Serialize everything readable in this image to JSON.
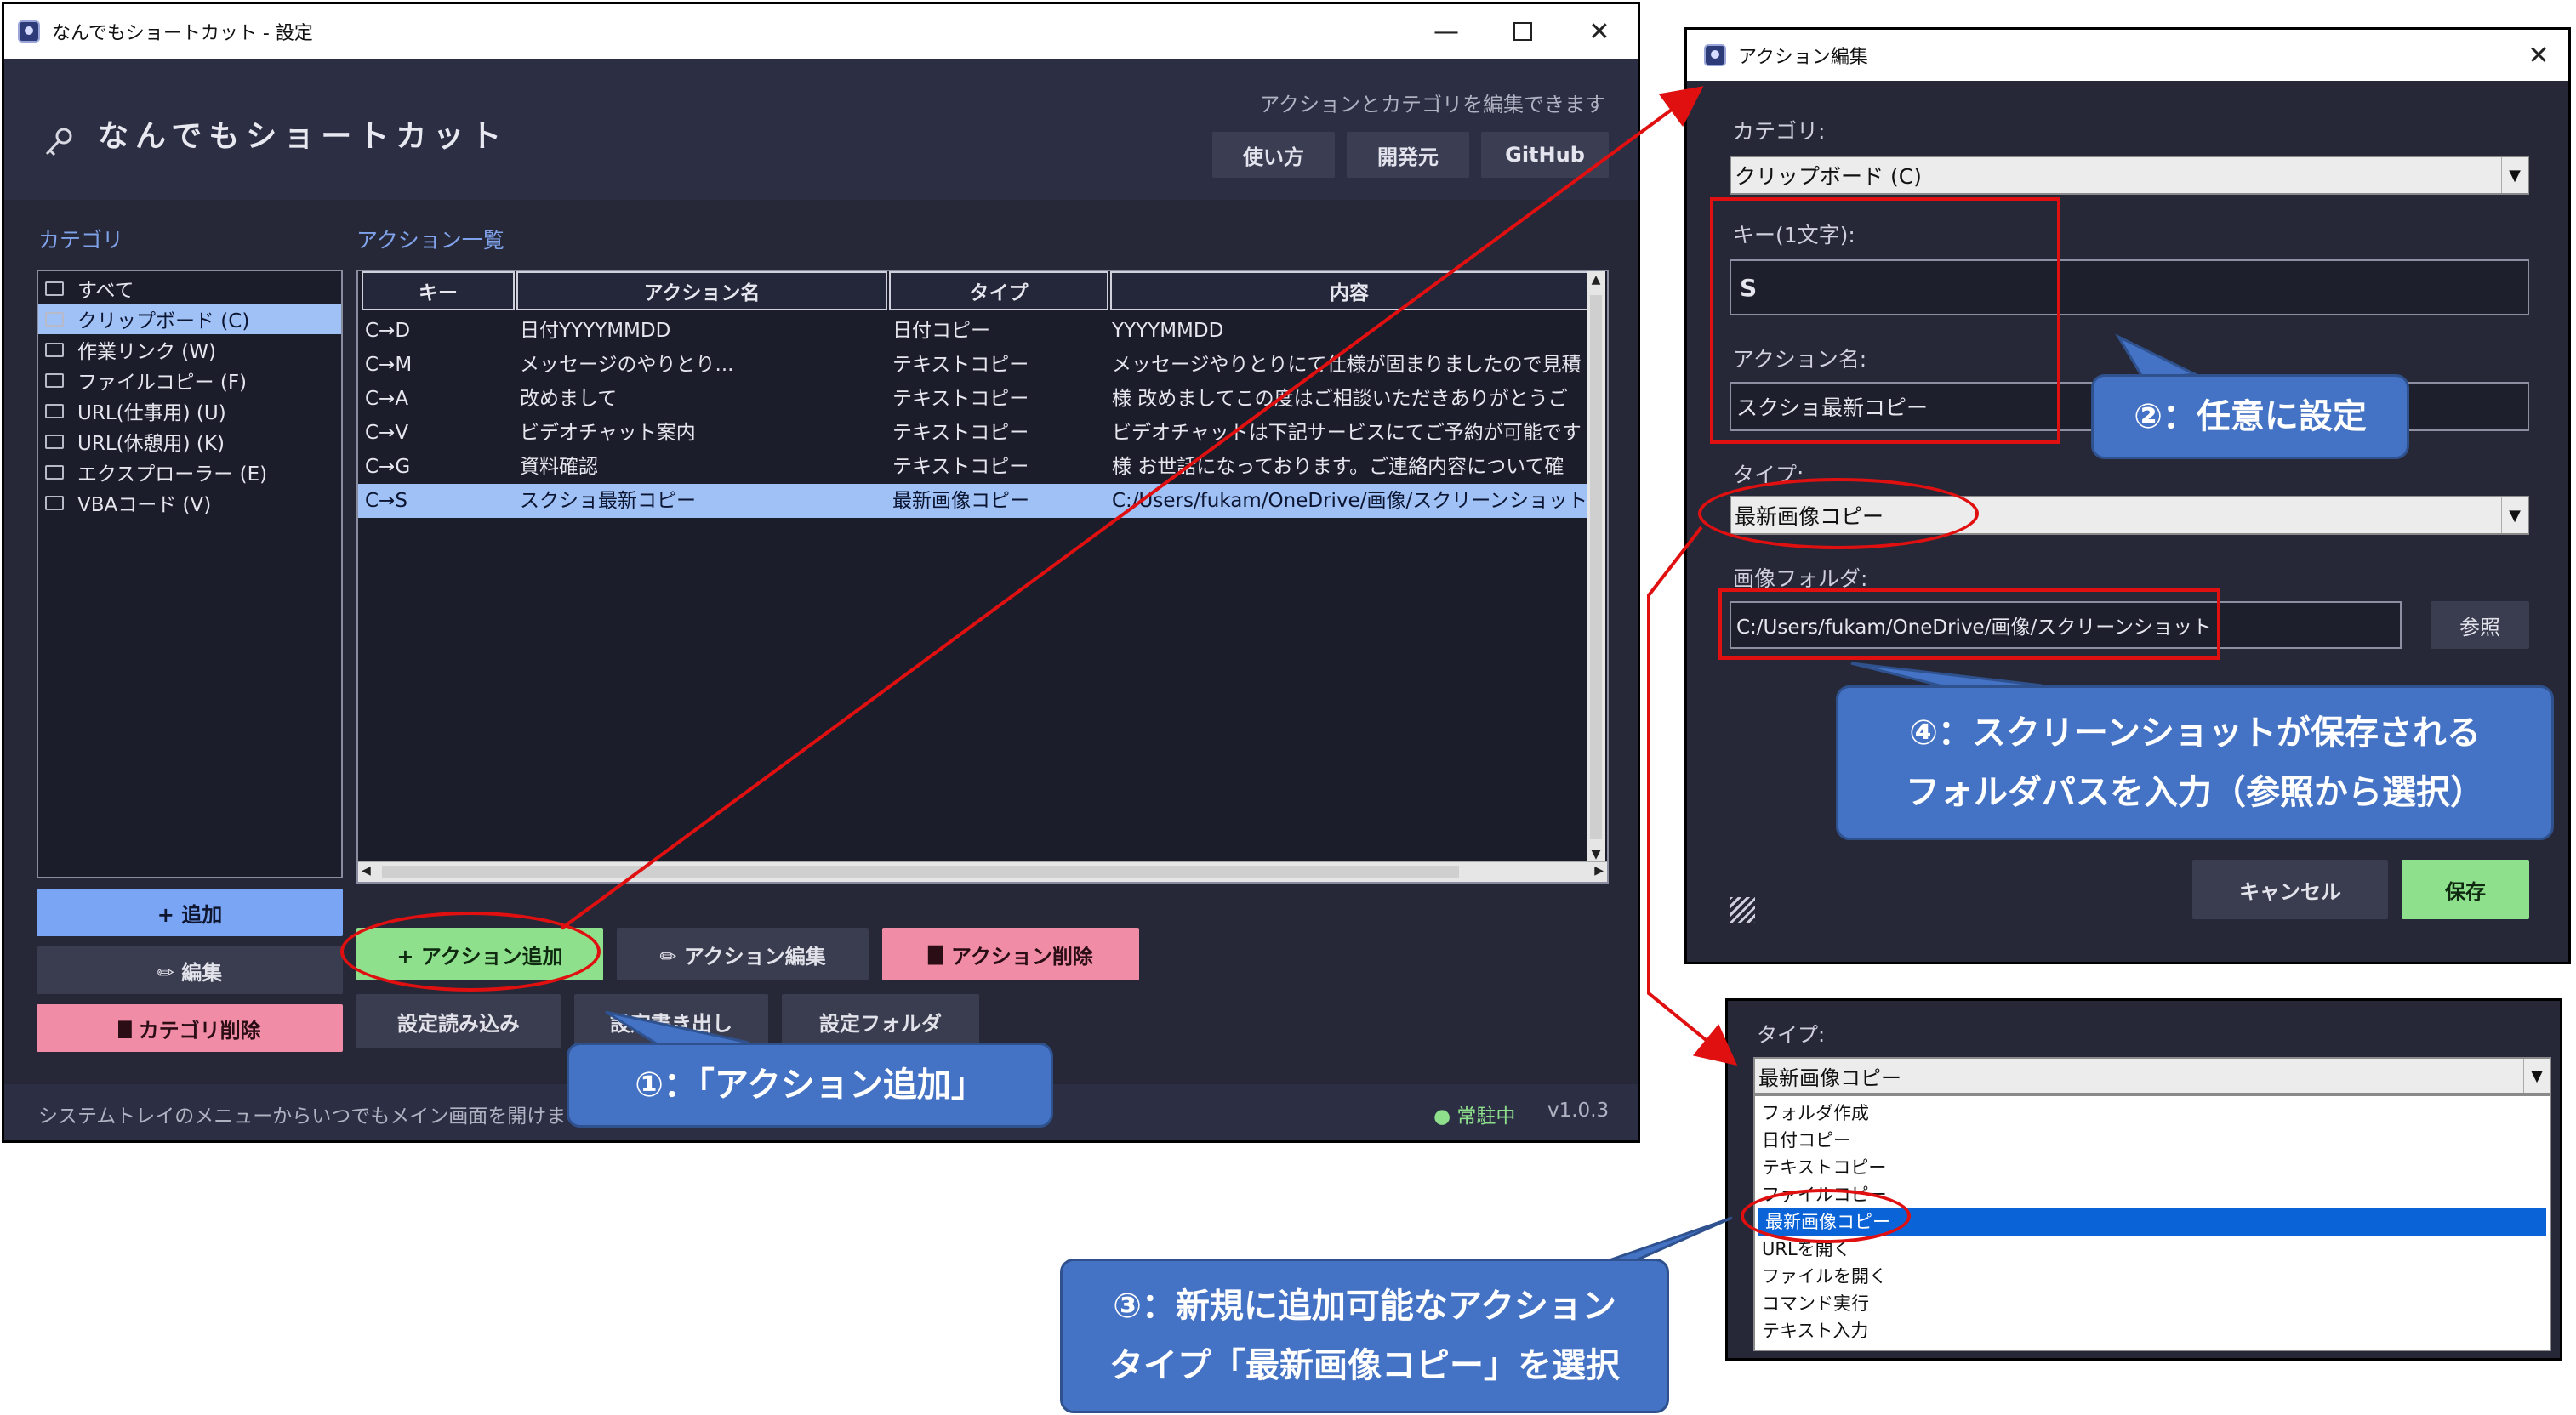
{
  "main_window": {
    "title": "なんでもショートカット - 設定",
    "app_name": "なんでもショートカット",
    "subtitle": "アクションとカテゴリを編集できます",
    "header_buttons": [
      "使い方",
      "開発元",
      "GitHub"
    ],
    "category_label": "カテゴリ",
    "action_list_label": "アクション一覧",
    "categories": [
      {
        "label": "すべて",
        "selected": false
      },
      {
        "label": "クリップボード (C)",
        "selected": true
      },
      {
        "label": "作業リンク (W)",
        "selected": false
      },
      {
        "label": "ファイルコピー (F)",
        "selected": false
      },
      {
        "label": "URL(仕事用) (U)",
        "selected": false
      },
      {
        "label": "URL(休憩用) (K)",
        "selected": false
      },
      {
        "label": "エクスプローラー (E)",
        "selected": false
      },
      {
        "label": "VBAコード (V)",
        "selected": false
      }
    ],
    "table": {
      "headers": [
        "キー",
        "アクション名",
        "タイプ",
        "内容"
      ],
      "rows": [
        {
          "key": "C→D",
          "name": "日付YYYYMMDD",
          "type": "日付コピー",
          "content": "YYYYMMDD",
          "selected": false
        },
        {
          "key": "C→M",
          "name": "メッセージのやりとり...",
          "type": "テキストコピー",
          "content": "メッセージやりとりにて仕様が固まりましたので見積",
          "selected": false
        },
        {
          "key": "C→A",
          "name": "改めまして",
          "type": "テキストコピー",
          "content": "様 改めましてこの度はご相談いただきありがとうご",
          "selected": false
        },
        {
          "key": "C→V",
          "name": "ビデオチャット案内",
          "type": "テキストコピー",
          "content": "ビデオチャットは下記サービスにてご予約が可能です",
          "selected": false
        },
        {
          "key": "C→G",
          "name": "資料確認",
          "type": "テキストコピー",
          "content": "様 お世話になっております。ご連絡内容について確",
          "selected": false
        },
        {
          "key": "C→S",
          "name": "スクショ最新コピー",
          "type": "最新画像コピー",
          "content": "C:/Users/fukam/OneDrive/画像/スクリーンショット",
          "selected": true
        }
      ]
    },
    "category_buttons": {
      "add": "+ 追加",
      "edit": "✏ 編集",
      "delete": "カテゴリ削除"
    },
    "action_buttons": {
      "add": "+ アクション追加",
      "edit": "✏ アクション編集",
      "delete": "アクション削除"
    },
    "settings_buttons": {
      "import": "設定読み込み",
      "export": "設定書き出し",
      "folder": "設定フォルダ"
    },
    "status_text": "システムトレイのメニューからいつでもメイン画面を開けます",
    "status_indicator": "● 常駐中",
    "version": "v1.0.3"
  },
  "edit_dialog": {
    "title": "アクション編集",
    "category_label": "カテゴリ:",
    "category_value": "クリップボード (C)",
    "key_label": "キー(1文字):",
    "key_value": "S",
    "name_label": "アクション名:",
    "name_value": "スクショ最新コピー",
    "type_label": "タイプ:",
    "type_value": "最新画像コピー",
    "folder_label": "画像フォルダ:",
    "folder_value": "C:/Users/fukam/OneDrive/画像/スクリーンショット",
    "browse_button": "参照",
    "cancel_button": "キャンセル",
    "save_button": "保存"
  },
  "type_dropdown": {
    "label": "タイプ:",
    "value": "最新画像コピー",
    "options": [
      {
        "label": "フォルダ作成",
        "selected": false
      },
      {
        "label": "日付コピー",
        "selected": false
      },
      {
        "label": "テキストコピー",
        "selected": false
      },
      {
        "label": "ファイルコピー",
        "selected": false
      },
      {
        "label": "最新画像コピー",
        "selected": true
      },
      {
        "label": "URLを開く",
        "selected": false
      },
      {
        "label": "ファイルを開く",
        "selected": false
      },
      {
        "label": "コマンド実行",
        "selected": false
      },
      {
        "label": "テキスト入力",
        "selected": false
      }
    ]
  },
  "callouts": {
    "step1": "①：「アクション追加」",
    "step2": "②：任意に設定",
    "step3_line1": "③：新規に追加可能なアクション",
    "step3_line2": "タイプ「最新画像コピー」を選択",
    "step4_line1": "④：スクリーンショットが保存される",
    "step4_line2": "フォルダパスを入力（参照から選択）"
  },
  "colors": {
    "window_bg": "#262838",
    "accent_blue": "#7aa4f4",
    "add_green": "#8fe08c",
    "delete_pink": "#f08ca6",
    "callout_blue": "#4472c4",
    "annotation_red": "#e01010",
    "selection": "#9fc1f6"
  }
}
